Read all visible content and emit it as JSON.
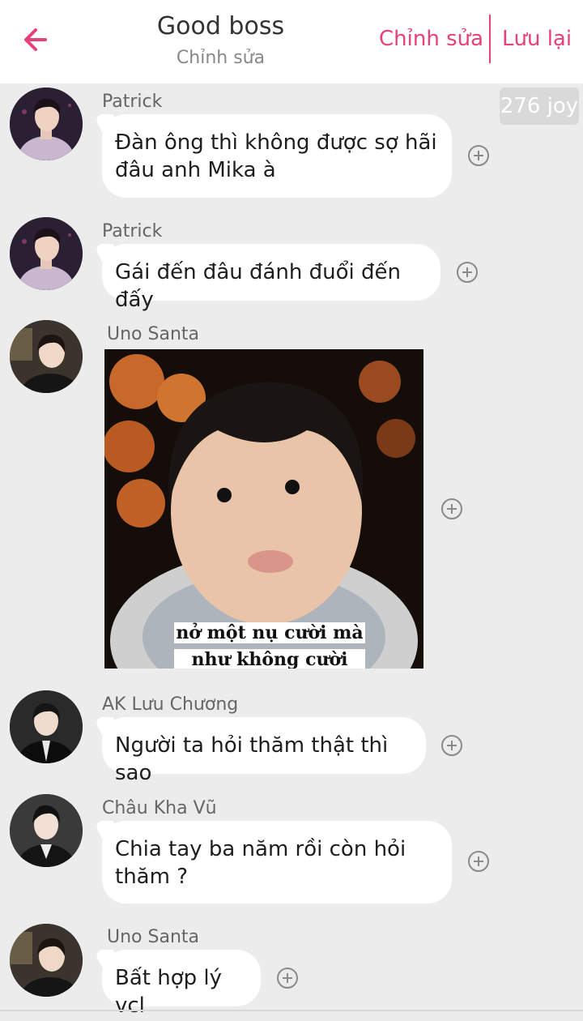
{
  "header": {
    "title": "Good boss",
    "subtitle": "Chỉnh sửa",
    "edit_label": "Chỉnh sửa",
    "save_label": "Lưu lại",
    "accent_color": "#e8407a"
  },
  "joy_badge": "276 joy",
  "messages": [
    {
      "sender": "Patrick",
      "text": "Đàn ông thì không được sợ hãi đâu anh Mika à"
    },
    {
      "sender": "Patrick",
      "text": "Gái đến đâu đánh đuổi đến đấy"
    },
    {
      "sender": "Uno Santa",
      "type": "image",
      "caption_line1": "nở một nụ cười mà",
      "caption_line2": "như không cười"
    },
    {
      "sender": "AK Lưu Chương",
      "text": "Người ta hỏi thăm thật thì sao"
    },
    {
      "sender": "Châu Kha Vũ",
      "text": "Chia tay ba năm rồi còn hỏi thăm ?"
    },
    {
      "sender": "Uno Santa",
      "text": "Bất hợp lý vcl"
    }
  ],
  "icons": {
    "back": "arrow-left-icon",
    "add": "plus-circle-icon"
  }
}
